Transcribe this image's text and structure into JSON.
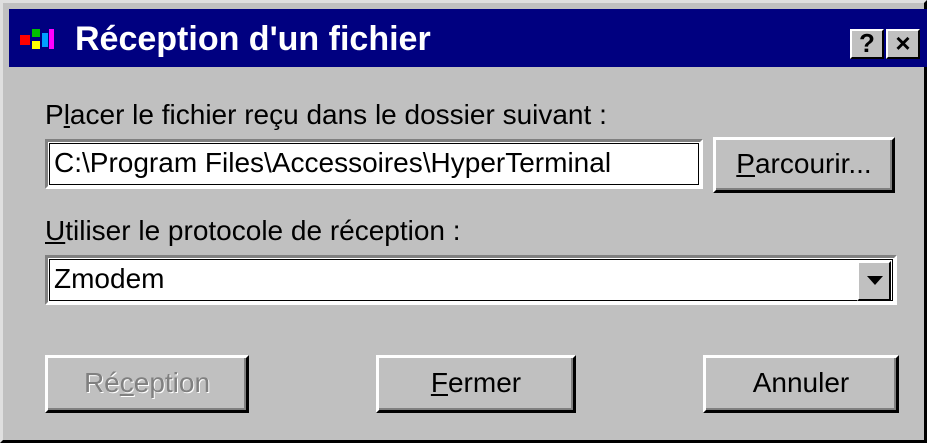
{
  "window": {
    "title": "Réception d'un fichier",
    "icon": "hyperterminal-app-icon",
    "help_button": "?",
    "close_button": "×"
  },
  "folder": {
    "label_underline": "l",
    "label_pre": "P",
    "label_post": "acer le fichier reçu dans le dossier suivant :",
    "path_value": "C:\\Program Files\\Accessoires\\HyperTerminal",
    "browse_underline": "P",
    "browse_rest": "arcourir..."
  },
  "protocol": {
    "label_underline": "U",
    "label_rest": "tiliser le protocole de réception :",
    "selected": "Zmodem"
  },
  "buttons": {
    "receive_pre": "Ré",
    "receive_underline": "c",
    "receive_post": "eption",
    "close_underline": "F",
    "close_rest": "ermer",
    "cancel": "Annuler"
  }
}
